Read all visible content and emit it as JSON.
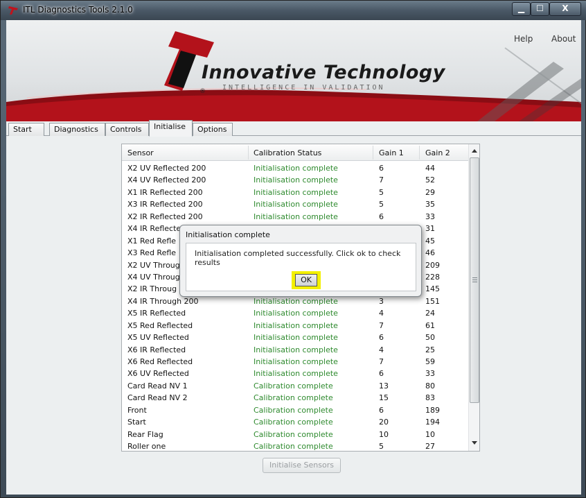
{
  "window": {
    "title": "ITL Diagnostics Tools 2.1.0",
    "minimize_label": "▁",
    "maximize_label": "☐",
    "close_label": "X"
  },
  "menu": {
    "help": "Help",
    "about": "About"
  },
  "banner": {
    "brand_name": "Innovative Technology",
    "tagline": "INTELLIGENCE IN VALIDATION",
    "registered_mark": "®"
  },
  "tabs": [
    {
      "label": "Start"
    },
    {
      "label": "Diagnostics"
    },
    {
      "label": "Controls"
    },
    {
      "label": "Initialise"
    },
    {
      "label": "Options"
    }
  ],
  "active_tab": "Initialise",
  "table": {
    "columns": [
      "Sensor",
      "Calibration Status",
      "Gain 1",
      "Gain 2"
    ],
    "rows": [
      [
        "X2 UV Reflected 200",
        "Initialisation complete",
        "6",
        "44"
      ],
      [
        "X4 UV Reflected 200",
        "Initialisation complete",
        "7",
        "52"
      ],
      [
        "X1 IR Reflected 200",
        "Initialisation complete",
        "5",
        "29"
      ],
      [
        "X3 IR Reflected 200",
        "Initialisation complete",
        "5",
        "35"
      ],
      [
        "X2 IR Reflected 200",
        "Initialisation complete",
        "6",
        "33"
      ],
      [
        "X4 IR Reflecte",
        "",
        "",
        "31"
      ],
      [
        "X1 Red Refle",
        "",
        "",
        "45"
      ],
      [
        "X3 Red Refle",
        "",
        "",
        "46"
      ],
      [
        "X2 UV Throug",
        "",
        "",
        "209"
      ],
      [
        "X4 UV Throug",
        "",
        "",
        "228"
      ],
      [
        "X2 IR Throug",
        "",
        "",
        "145"
      ],
      [
        "X4 IR Through 200",
        "Initialisation complete",
        "3",
        "151"
      ],
      [
        "X5 IR  Reflected",
        "Initialisation complete",
        "4",
        "24"
      ],
      [
        "X5 Red Reflected",
        "Initialisation complete",
        "7",
        "61"
      ],
      [
        "X5 UV  Reflected",
        "Initialisation complete",
        "6",
        "50"
      ],
      [
        "X6 IR  Reflected",
        "Initialisation complete",
        "4",
        "25"
      ],
      [
        "X6 Red Reflected",
        "Initialisation complete",
        "7",
        "59"
      ],
      [
        "X6 UV  Reflected",
        "Initialisation complete",
        "6",
        "33"
      ],
      [
        "Card Read NV 1",
        "Calibration complete",
        "13",
        "80"
      ],
      [
        "Card Read NV 2",
        "Calibration complete",
        "15",
        "83"
      ],
      [
        "Front",
        "Calibration complete",
        "6",
        "189"
      ],
      [
        "Start",
        "Calibration complete",
        "20",
        "194"
      ],
      [
        "Rear Flag",
        "Calibration complete",
        "10",
        "10"
      ],
      [
        "Roller one",
        "Calibration complete",
        "5",
        "27"
      ]
    ]
  },
  "initialise_button": "Initialise Sensors",
  "dialog": {
    "title": "Initialisation complete",
    "message": "Initialisation completed successfully. Click ok to check results",
    "ok_label": "OK"
  },
  "colors": {
    "status_green": "#2e8a2e",
    "ok_highlight": "#f3f000",
    "brand_red": "#b3121b"
  }
}
